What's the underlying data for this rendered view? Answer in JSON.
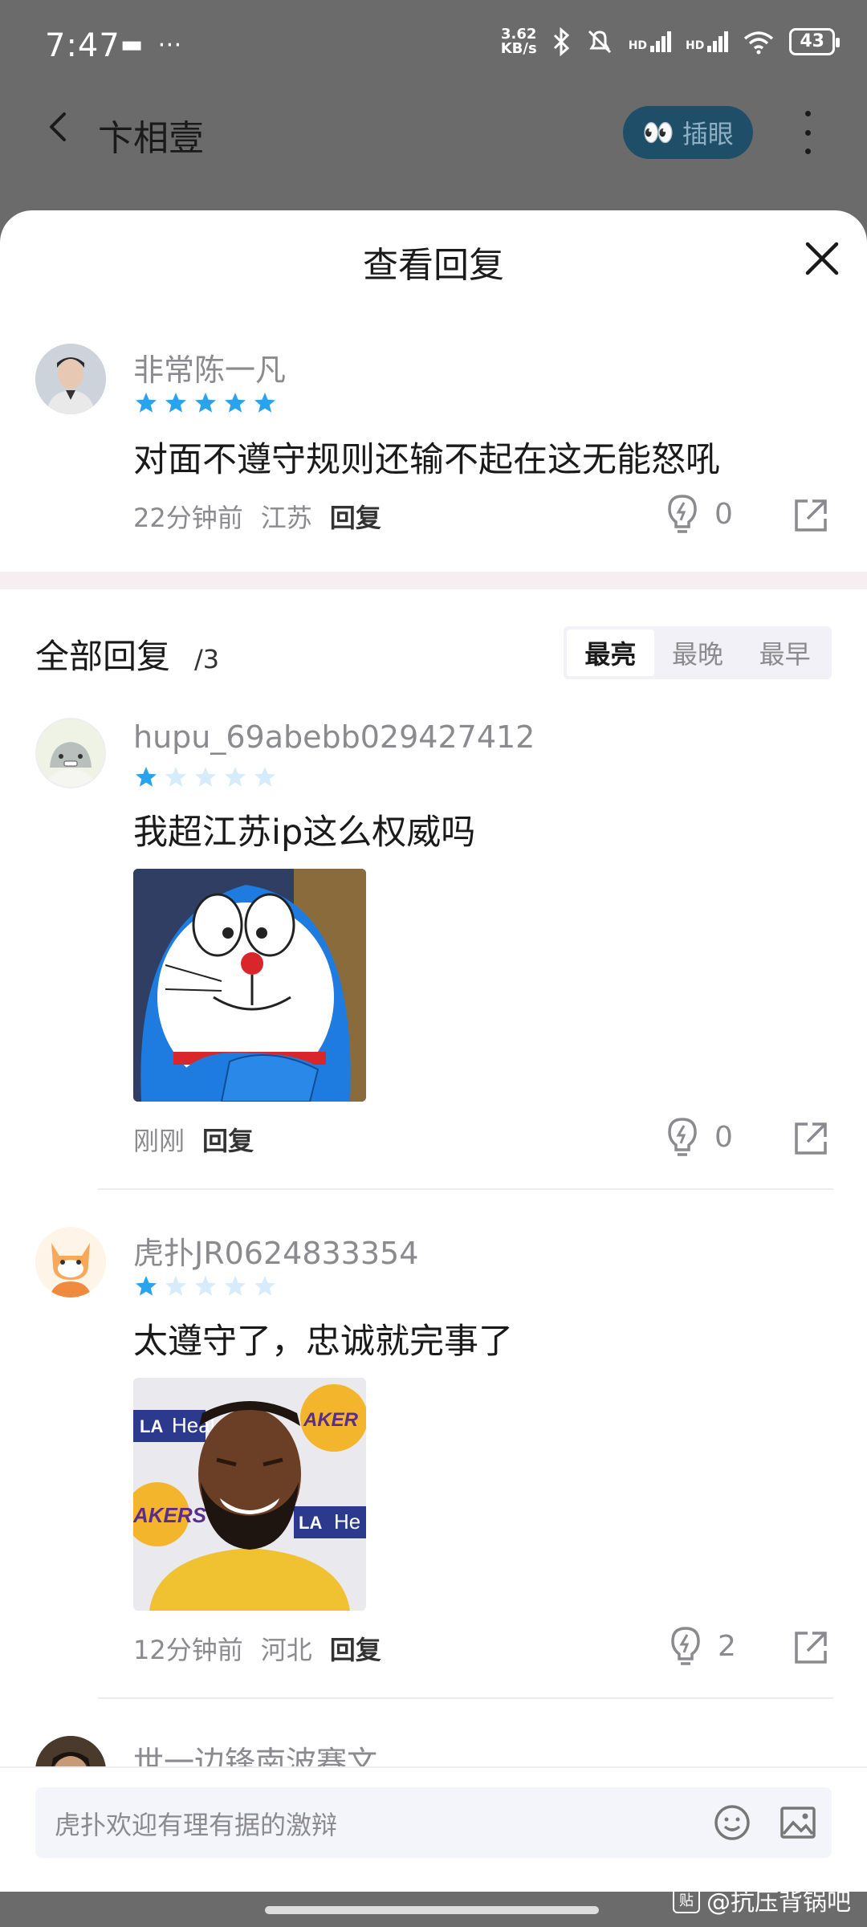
{
  "status_bar": {
    "time": "7:47",
    "net_speed_value": "3.62",
    "net_speed_unit": "KB/s",
    "battery": "43",
    "signal1": "HD",
    "signal2": "HD"
  },
  "header": {
    "title": "卞相壹",
    "peek_button_label": "插眼",
    "peek_button_emoji": "👀"
  },
  "sheet": {
    "title": "查看回复",
    "main_comment": {
      "username": "非常陈一凡",
      "stars": 5,
      "text": "对面不遵守规则还输不起在这无能怒吼",
      "time": "22分钟前",
      "location": "江苏",
      "reply_label": "回复",
      "likes": "0"
    },
    "all_replies_title": "全部回复",
    "all_replies_count": "/3",
    "sort_tabs": [
      "最亮",
      "最晚",
      "最早"
    ],
    "replies": [
      {
        "username": "hupu_69abebb029427412",
        "stars": 1,
        "text": "我超江苏ip这么权威吗",
        "time": "刚刚",
        "location": "",
        "reply_label": "回复",
        "likes": "0"
      },
      {
        "username": "虎扑JR0624833354",
        "stars": 1,
        "text": "太遵守了，忠诚就完事了",
        "time": "12分钟前",
        "location": "河北",
        "reply_label": "回复",
        "likes": "2"
      },
      {
        "username": "世一边锋南波赛文"
      }
    ],
    "sticker2_texts": {
      "a": "LA",
      "b": "Heal",
      "c": "AKERS",
      "d": "LA",
      "e": "He",
      "f": "AKER"
    }
  },
  "input": {
    "placeholder": "虎扑欢迎有理有据的激辩"
  },
  "watermark": {
    "badge": "贴",
    "text": "@抗压背锅吧"
  },
  "colors": {
    "star_filled": "#2aa3ee",
    "star_empty": "#d7ecfb",
    "peek_bg": "#1f4e69",
    "dim_bg": "#6b6b6b"
  }
}
